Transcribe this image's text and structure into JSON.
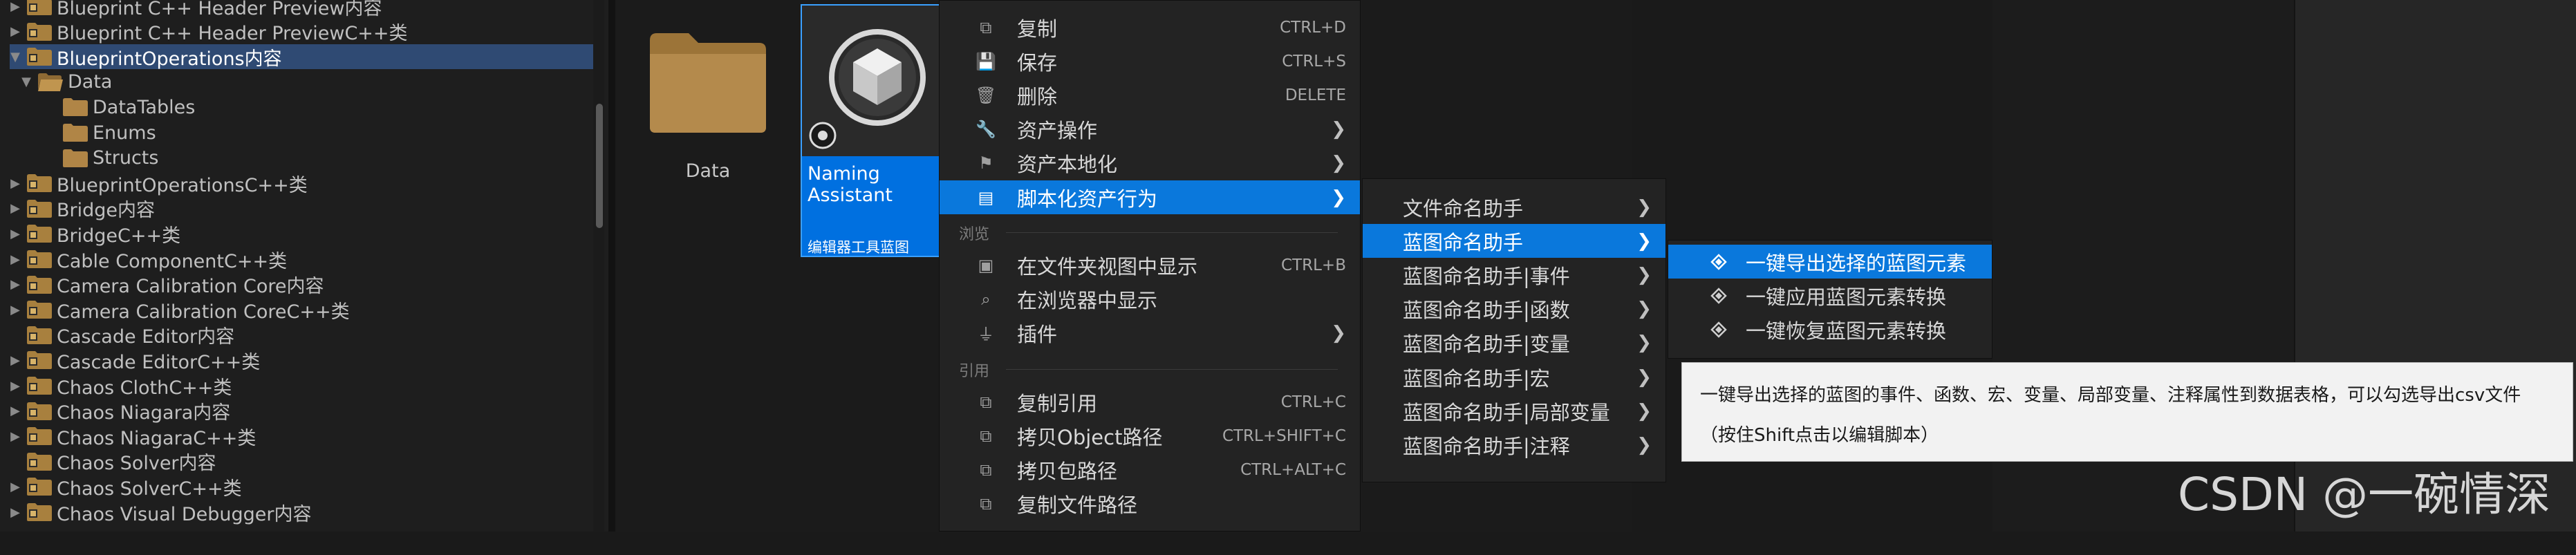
{
  "tree": {
    "items": [
      {
        "label": "Blueprint C++ Header Preview内容",
        "expandable": true,
        "expanded": false,
        "type": "plugin-folder"
      },
      {
        "label": "Blueprint C++ Header PreviewC++类",
        "expandable": true,
        "expanded": false,
        "type": "plugin-folder"
      },
      {
        "label": "BlueprintOperations内容",
        "expandable": true,
        "expanded": true,
        "type": "plugin-folder",
        "selected": true
      },
      {
        "label": "Data",
        "expandable": true,
        "expanded": true,
        "type": "folder-open"
      },
      {
        "label": "DataTables",
        "expandable": false,
        "type": "folder"
      },
      {
        "label": "Enums",
        "expandable": false,
        "type": "folder"
      },
      {
        "label": "Structs",
        "expandable": false,
        "type": "folder"
      },
      {
        "label": "BlueprintOperationsC++类",
        "expandable": true,
        "expanded": false,
        "type": "plugin-folder"
      },
      {
        "label": "Bridge内容",
        "expandable": true,
        "expanded": false,
        "type": "plugin-folder"
      },
      {
        "label": "BridgeC++类",
        "expandable": true,
        "expanded": false,
        "type": "plugin-folder"
      },
      {
        "label": "Cable ComponentC++类",
        "expandable": true,
        "expanded": false,
        "type": "plugin-folder"
      },
      {
        "label": "Camera Calibration Core内容",
        "expandable": true,
        "expanded": false,
        "type": "plugin-folder"
      },
      {
        "label": "Camera Calibration CoreC++类",
        "expandable": true,
        "expanded": false,
        "type": "plugin-folder"
      },
      {
        "label": "Cascade Editor内容",
        "expandable": false,
        "type": "plugin-folder"
      },
      {
        "label": "Cascade EditorC++类",
        "expandable": true,
        "expanded": false,
        "type": "plugin-folder"
      },
      {
        "label": "Chaos ClothC++类",
        "expandable": true,
        "expanded": false,
        "type": "plugin-folder"
      },
      {
        "label": "Chaos Niagara内容",
        "expandable": true,
        "expanded": false,
        "type": "plugin-folder"
      },
      {
        "label": "Chaos NiagaraC++类",
        "expandable": true,
        "expanded": false,
        "type": "plugin-folder"
      },
      {
        "label": "Chaos Solver内容",
        "expandable": false,
        "type": "plugin-folder"
      },
      {
        "label": "Chaos SolverC++类",
        "expandable": true,
        "expanded": false,
        "type": "plugin-folder"
      },
      {
        "label": "Chaos Visual Debugger内容",
        "expandable": true,
        "expanded": false,
        "type": "plugin-folder"
      }
    ]
  },
  "content": {
    "folder_label": "Data",
    "asset": {
      "name_line1": "Naming",
      "name_line2": "Assistant",
      "type": "编辑器工具蓝图"
    }
  },
  "context_menu": {
    "items": [
      {
        "icon": "copy-icon",
        "label": "复制",
        "shortcut": "CTRL+D"
      },
      {
        "icon": "save-icon",
        "label": "保存",
        "shortcut": "CTRL+S"
      },
      {
        "icon": "trash-icon",
        "label": "删除",
        "shortcut": "DELETE"
      },
      {
        "icon": "wrench-icon",
        "label": "资产操作",
        "submenu": true
      },
      {
        "icon": "flag-icon",
        "label": "资产本地化",
        "submenu": true
      },
      {
        "icon": "script-icon",
        "label": "脚本化资产行为",
        "submenu": true,
        "highlighted": true
      }
    ],
    "section_browse": "浏览",
    "browse_items": [
      {
        "icon": "folder-view-icon",
        "label": "在文件夹视图中显示",
        "shortcut": "CTRL+B"
      },
      {
        "icon": "browser-search-icon",
        "label": "在浏览器中显示"
      },
      {
        "icon": "plugin-icon",
        "label": "插件",
        "submenu": true
      }
    ],
    "section_reference": "引用",
    "reference_items": [
      {
        "icon": "copy-ref-icon",
        "label": "复制引用",
        "shortcut": "CTRL+C"
      },
      {
        "icon": "copy-path-icon",
        "label": "拷贝Object路径",
        "shortcut": "CTRL+SHIFT+C"
      },
      {
        "icon": "copy-package-icon",
        "label": "拷贝包路径",
        "shortcut": "CTRL+ALT+C"
      },
      {
        "icon": "copy-file-icon",
        "label": "复制文件路径"
      }
    ]
  },
  "submenu_scripted": {
    "items": [
      {
        "label": "文件命名助手",
        "submenu": true
      },
      {
        "label": "蓝图命名助手",
        "submenu": true,
        "highlighted": true
      },
      {
        "label": "蓝图命名助手|事件",
        "submenu": true
      },
      {
        "label": "蓝图命名助手|函数",
        "submenu": true
      },
      {
        "label": "蓝图命名助手|变量",
        "submenu": true
      },
      {
        "label": "蓝图命名助手|宏",
        "submenu": true
      },
      {
        "label": "蓝图命名助手|局部变量",
        "submenu": true
      },
      {
        "label": "蓝图命名助手|注释",
        "submenu": true
      }
    ]
  },
  "submenu_blueprint": {
    "items": [
      {
        "label": "一键导出选择的蓝图元素",
        "highlighted": true
      },
      {
        "label": "一键应用蓝图元素转换"
      },
      {
        "label": "一键恢复蓝图元素转换"
      }
    ]
  },
  "tooltip": {
    "line1": "一键导出选择的蓝图的事件、函数、宏、变量、局部变量、注释属性到数据表格，可以勾选导出csv文件",
    "line2": "（按住Shift点击以编辑脚本）"
  },
  "watermark": "CSDN @一碗情深",
  "colors": {
    "highlight": "#0a78dc",
    "selected_row": "#2f4a73",
    "folder": "#b58a4a",
    "menu_bg": "#232323",
    "tooltip_bg": "#f2f2f2"
  }
}
